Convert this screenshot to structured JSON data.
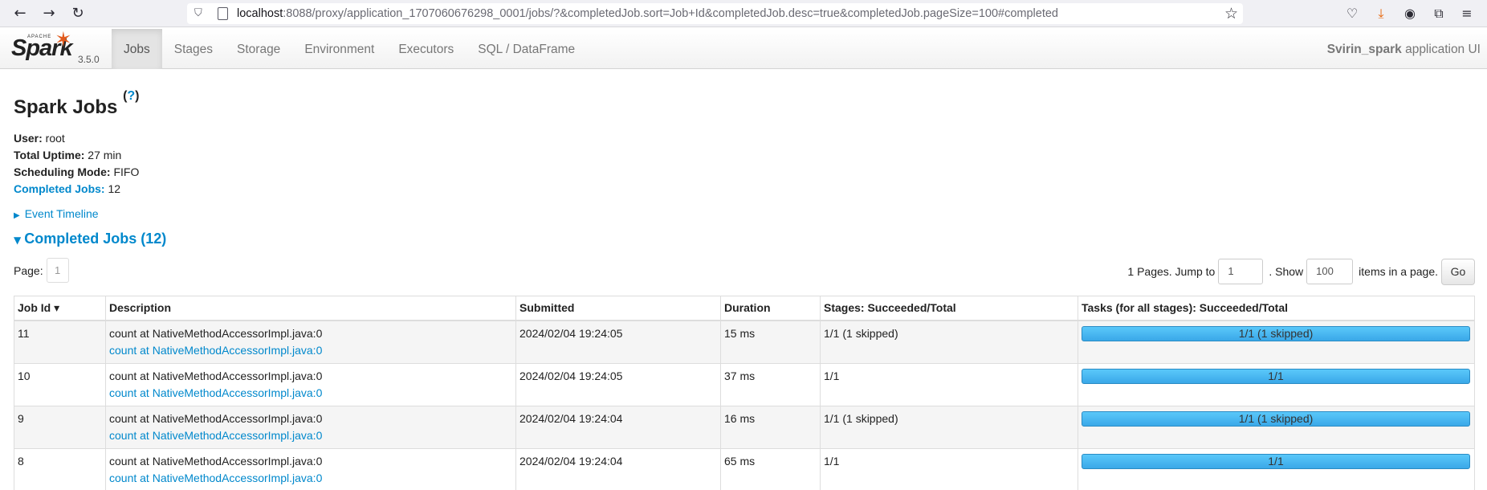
{
  "browser": {
    "url_host": "localhost",
    "url_rest": ":8088/proxy/application_1707060676298_0001/jobs/?&completedJob.sort=Job+Id&completedJob.desc=true&completedJob.pageSize=100#completed"
  },
  "navbar": {
    "brand_apache": "APACHE",
    "brand_name": "Spark",
    "version": "3.5.0",
    "tabs": [
      {
        "label": "Jobs",
        "active": true
      },
      {
        "label": "Stages"
      },
      {
        "label": "Storage"
      },
      {
        "label": "Environment"
      },
      {
        "label": "Executors"
      },
      {
        "label": "SQL / DataFrame"
      }
    ],
    "app_name": "Svirin_spark",
    "app_suffix": " application UI"
  },
  "page": {
    "title": "Spark Jobs",
    "help": "?",
    "user_label": "User:",
    "user_value": " root",
    "uptime_label": "Total Uptime:",
    "uptime_value": " 27 min",
    "mode_label": "Scheduling Mode:",
    "mode_value": " FIFO",
    "completed_label": "Completed Jobs:",
    "completed_value": " 12",
    "event_timeline": "Event Timeline",
    "section_title": "Completed Jobs (12)"
  },
  "pager": {
    "page_label": "Page:",
    "page_num": "1",
    "pages_text": "1 Pages. Jump to",
    "jump_value": "1",
    "show_text": ". Show",
    "show_value": "100",
    "items_text": "items in a page.",
    "go": "Go"
  },
  "table": {
    "headers": [
      "Job Id ▾",
      "Description",
      "Submitted",
      "Duration",
      "Stages: Succeeded/Total",
      "Tasks (for all stages): Succeeded/Total"
    ],
    "rows": [
      {
        "id": "11",
        "desc": "count at NativeMethodAccessorImpl.java:0",
        "link": "count at NativeMethodAccessorImpl.java:0",
        "submitted": "2024/02/04 19:24:05",
        "duration": "15 ms",
        "stages": "1/1 (1 skipped)",
        "tasks": "1/1 (1 skipped)",
        "tasks_fraction": 1.0
      },
      {
        "id": "10",
        "desc": "count at NativeMethodAccessorImpl.java:0",
        "link": "count at NativeMethodAccessorImpl.java:0",
        "submitted": "2024/02/04 19:24:05",
        "duration": "37 ms",
        "stages": "1/1",
        "tasks": "1/1",
        "tasks_fraction": 1.0
      },
      {
        "id": "9",
        "desc": "count at NativeMethodAccessorImpl.java:0",
        "link": "count at NativeMethodAccessorImpl.java:0",
        "submitted": "2024/02/04 19:24:04",
        "duration": "16 ms",
        "stages": "1/1 (1 skipped)",
        "tasks": "1/1 (1 skipped)",
        "tasks_fraction": 1.0
      },
      {
        "id": "8",
        "desc": "count at NativeMethodAccessorImpl.java:0",
        "link": "count at NativeMethodAccessorImpl.java:0",
        "submitted": "2024/02/04 19:24:04",
        "duration": "65 ms",
        "stages": "1/1",
        "tasks": "1/1",
        "tasks_fraction": 1.0
      }
    ]
  }
}
